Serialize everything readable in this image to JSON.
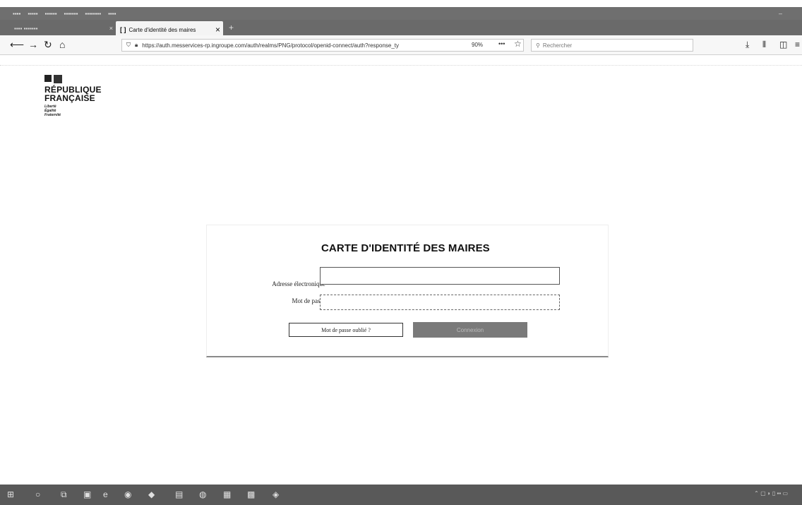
{
  "browser": {
    "active_tab_title": "Carte d'identité des maires",
    "url": "https://auth.messervices-rp.ingroupe.com/auth/realms/PNG/protocol/openid-connect/auth?response_ty",
    "zoom": "90%",
    "search_placeholder": "Rechercher"
  },
  "logo": {
    "line1": "RÉPUBLIQUE",
    "line2": "FRANÇAISE",
    "motto1": "Liberté",
    "motto2": "Égalité",
    "motto3": "Fraternité"
  },
  "login": {
    "title": "CARTE D'IDENTITÉ DES MAIRES",
    "email_label": "Adresse électronique",
    "password_label": "Mot de passe",
    "forgot_label": "Mot de passe oublié ?",
    "submit_label": "Connexion"
  }
}
